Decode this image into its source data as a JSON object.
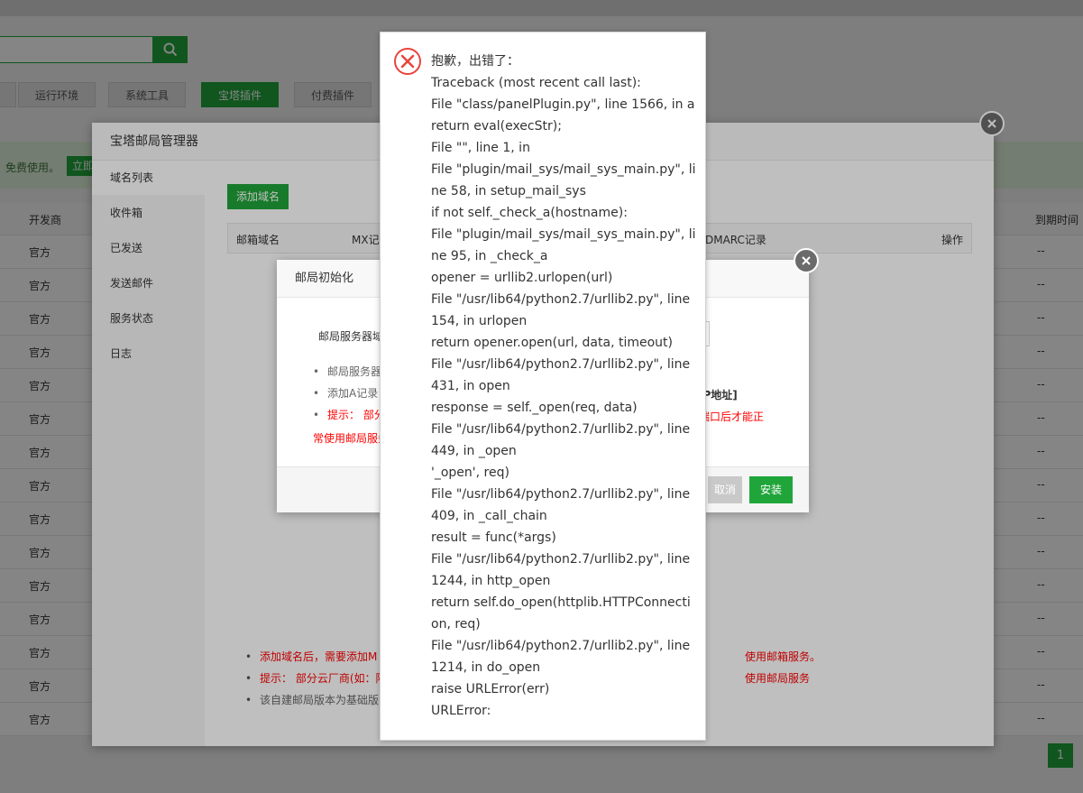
{
  "background": {
    "tabs": [
      "运行环境",
      "系统工具",
      "宝塔插件",
      "付费插件"
    ],
    "active_tab": "宝塔插件",
    "notice_text": "免费使用。",
    "notice_button": "立即",
    "columns": {
      "developer": "开发商",
      "expiry": "到期时间"
    },
    "rows": [
      {
        "developer": "官方",
        "expiry": "--"
      },
      {
        "developer": "官方",
        "expiry": "--"
      },
      {
        "developer": "官方",
        "expiry": "--"
      },
      {
        "developer": "官方",
        "expiry": "--"
      },
      {
        "developer": "官方",
        "expiry": "--"
      },
      {
        "developer": "官方",
        "expiry": "--"
      },
      {
        "developer": "官方",
        "expiry": "--"
      },
      {
        "developer": "官方",
        "expiry": "--"
      },
      {
        "developer": "官方",
        "expiry": "--"
      },
      {
        "developer": "官方",
        "expiry": "--"
      },
      {
        "developer": "官方",
        "expiry": "--"
      },
      {
        "developer": "官方",
        "expiry": "--"
      },
      {
        "developer": "官方",
        "expiry": "--"
      },
      {
        "developer": "官方",
        "expiry": "--"
      },
      {
        "developer": "官方",
        "expiry": "--"
      }
    ],
    "page": "1"
  },
  "manager": {
    "title": "宝塔邮局管理器",
    "sidebar": [
      "域名列表",
      "收件箱",
      "已发送",
      "发送邮件",
      "服务状态",
      "日志"
    ],
    "add_domain": "添加域名",
    "columns": {
      "domain": "邮箱域名",
      "mx": "MX记",
      "dmarc": "DMARC记录",
      "ops": "操作"
    },
    "tips": [
      {
        "text": "添加域名后，需要添加M",
        "suffix": "使用邮箱服务。"
      },
      {
        "text": "提示： 部分云厂商(如：阿",
        "suffix": "使用邮局服务"
      },
      {
        "text": "该自建邮局版本为基础版",
        "suffix": ""
      }
    ]
  },
  "init": {
    "title": "邮局初始化",
    "label": "邮局服务器域",
    "items": [
      "邮局服务器",
      "添加A记录",
      "提示： 部分"
    ],
    "ip_text": "IP地址]",
    "red_right": "端口后才能正",
    "red_left": "常使用邮局服务",
    "cancel": "取消",
    "install": "安装"
  },
  "error": {
    "lines": [
      "抱歉，出错了：",
      "Traceback (most recent call last):",
      "File \"class/panelPlugin.py\", line 1566, in a",
      "return eval(execStr);",
      "File \"\", line 1, in",
      "File \"plugin/mail_sys/mail_sys_main.py\", li",
      "ne 58, in setup_mail_sys",
      "if not self._check_a(hostname):",
      "File \"plugin/mail_sys/mail_sys_main.py\", li",
      "ne 95, in _check_a",
      "opener = urllib2.urlopen(url)",
      "File \"/usr/lib64/python2.7/urllib2.py\", line",
      "154, in urlopen",
      "return opener.open(url, data, timeout)",
      "File \"/usr/lib64/python2.7/urllib2.py\", line",
      "431, in open",
      "response = self._open(req, data)",
      "File \"/usr/lib64/python2.7/urllib2.py\", line",
      "449, in _open",
      "'_open', req)",
      "File \"/usr/lib64/python2.7/urllib2.py\", line",
      "409, in _call_chain",
      "result = func(*args)",
      "File \"/usr/lib64/python2.7/urllib2.py\", line",
      "1244, in http_open",
      "return self.do_open(httplib.HTTPConnecti",
      "on, req)",
      "File \"/usr/lib64/python2.7/urllib2.py\", line",
      "1214, in do_open",
      "raise URLError(err)",
      "URLError:"
    ]
  },
  "colors": {
    "accent": "#20a53a",
    "error": "#e8453c",
    "warning_text": "#ff0000"
  }
}
